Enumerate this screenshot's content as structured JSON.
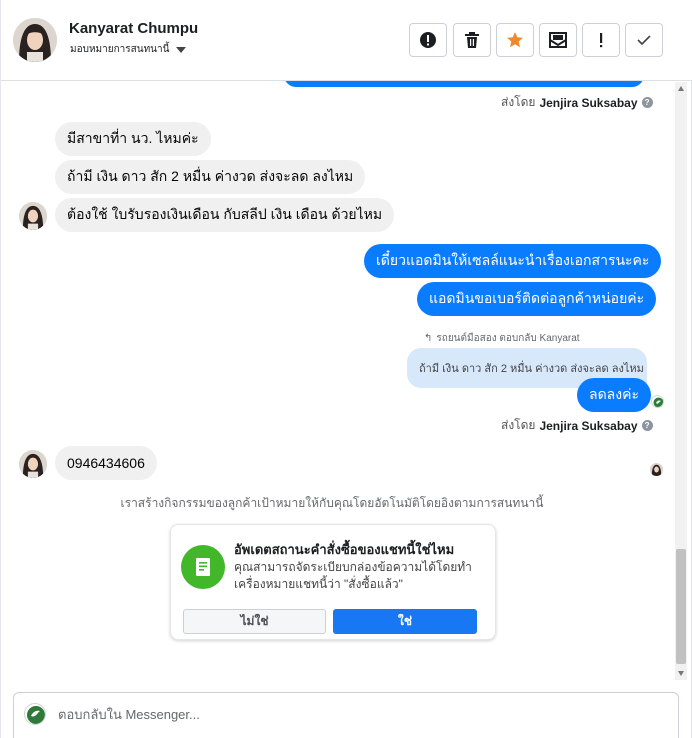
{
  "header": {
    "name": "Kanyarat Chumpu",
    "assign_label": "มอบหมายการสนทนานี้"
  },
  "toolbar": [
    {
      "name": "report-spam-button",
      "icon": "alert-circle-icon"
    },
    {
      "name": "delete-button",
      "icon": "trash-icon"
    },
    {
      "name": "star-button",
      "icon": "star-icon",
      "color": "#f0892e"
    },
    {
      "name": "mark-unread-button",
      "icon": "envelope-icon"
    },
    {
      "name": "follow-up-button",
      "icon": "exclamation-icon"
    },
    {
      "name": "mark-done-button",
      "icon": "check-icon"
    }
  ],
  "messages": {
    "sent_by_top": {
      "prefix": "ส่งโดย",
      "name": "Jenjira Suksabay"
    },
    "in_1": "มีสาขาที่า นว. ไหมค่ะ",
    "in_2": "ถ้ามี เงิน ดาว สัก 2 หมื่น ค่างวด ส่งจะลด ลงไหม",
    "in_3": "ต้องใช้ ใบรับรองเงินเดือน กับสลีป เงิน เดือน ด้วยไหม",
    "out_1": "เดี๋ยวแอดมินให้เซลล์แนะนำเรื่องเอกสารนะคะ",
    "out_2": "แอดมินขอเบอร์ติดต่อลูกค้าหน่อยค่ะ",
    "reply_label": "รถยนต์มือสอง ตอบกลับ Kanyarat",
    "quoted": "ถ้ามี เงิน ดาว สัก 2 หมื่น ค่างวด ส่งจะลด ลงไหม",
    "out_3": "ลดลงค่ะ",
    "sent_by_bottom": {
      "prefix": "ส่งโดย",
      "name": "Jenjira Suksabay"
    },
    "in_4": "0946434606"
  },
  "automation_notice": "เราสร้างกิจกรรมของลูกค้าเป้าหมายให้กับคุณโดยอัตโนมัติโดยอิงตามการสนทนานี้",
  "order_card": {
    "title": "อัพเดตสถานะคำสั่งซื้อของแชทนี้ใช่ไหม",
    "description": "คุณสามารถจัดระเบียบกล่องข้อความได้โดยทำเครื่องหมายแชทนี้ว่า \"สั่งซื้อแล้ว\"",
    "no_label": "ไม่ใช่",
    "yes_label": "ใช่",
    "icon": "receipt-icon",
    "icon_color": "#42b72a"
  },
  "composer": {
    "placeholder": "ตอบกลับใน Messenger..."
  },
  "colors": {
    "outgoing": "#0a7cff",
    "incoming": "#f0f0f0",
    "quoted": "#d8e8fb",
    "primary_button": "#1877f2"
  }
}
